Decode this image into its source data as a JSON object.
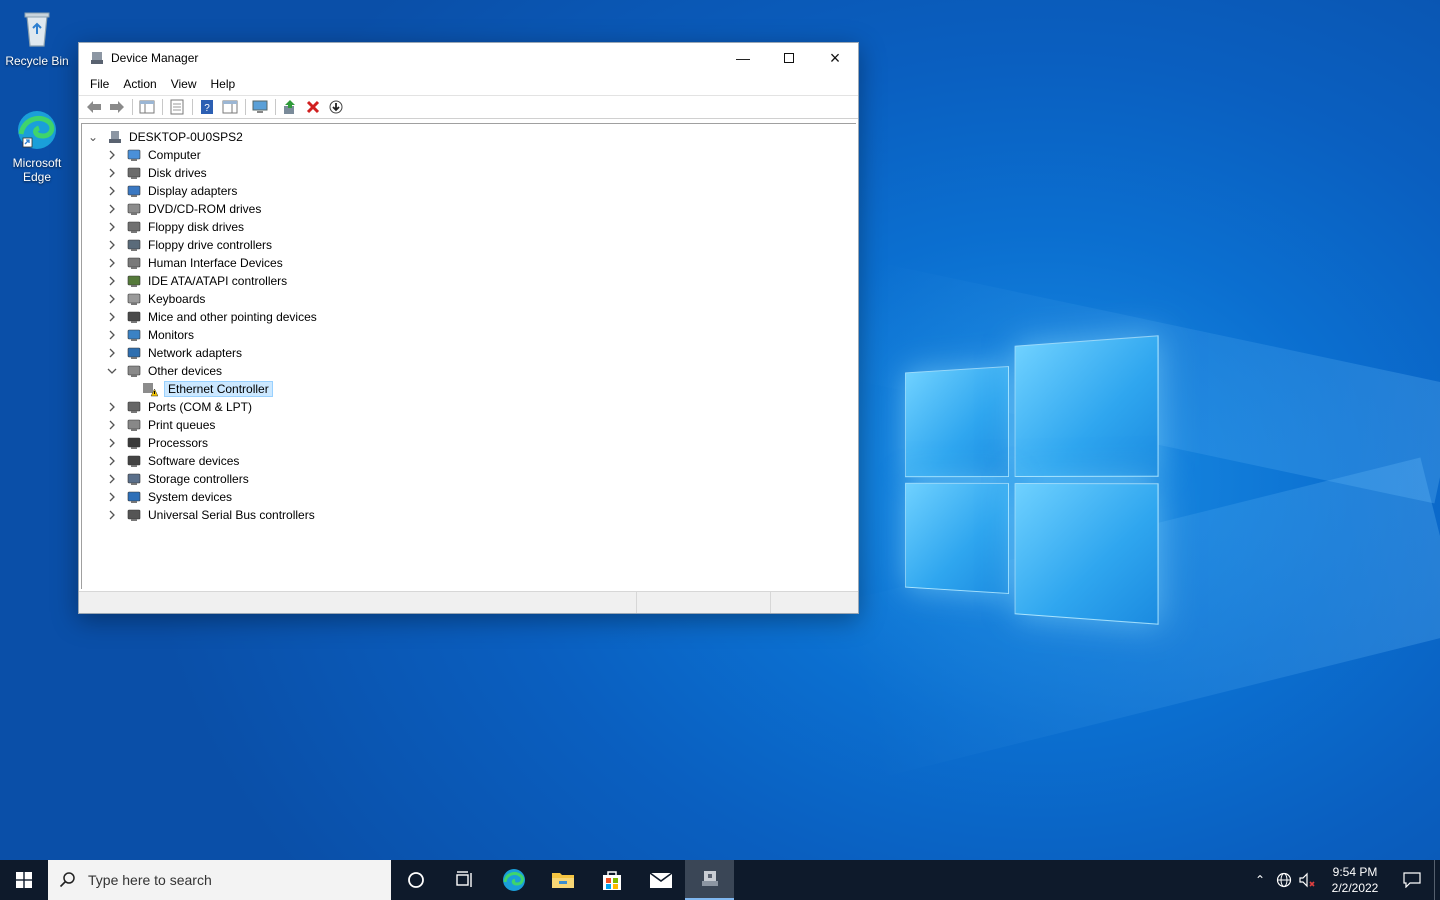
{
  "desktop": {
    "icons": [
      {
        "label": "Recycle Bin",
        "icon": "recycle-bin-icon"
      },
      {
        "label": "Microsoft Edge",
        "icon": "edge-icon"
      }
    ]
  },
  "window": {
    "title": "Device Manager",
    "controls": {
      "minimize": "minimize-icon",
      "maximize": "maximize-icon",
      "close": "close-icon"
    },
    "menu": [
      "File",
      "Action",
      "View",
      "Help"
    ],
    "toolbar_icons": [
      "back-icon",
      "forward-icon",
      "show-hide-tree-icon",
      "properties-icon",
      "help-icon",
      "action-pane-icon",
      "scan-hardware-icon",
      "update-driver-icon",
      "uninstall-icon",
      "disable-icon"
    ],
    "tree": {
      "root": "DESKTOP-0U0SPS2",
      "items": [
        {
          "label": "Computer",
          "icon": "computer-icon",
          "expanded": false
        },
        {
          "label": "Disk drives",
          "icon": "disk-drive-icon",
          "expanded": false
        },
        {
          "label": "Display adapters",
          "icon": "display-adapter-icon",
          "expanded": false
        },
        {
          "label": "DVD/CD-ROM drives",
          "icon": "dvd-icon",
          "expanded": false
        },
        {
          "label": "Floppy disk drives",
          "icon": "floppy-icon",
          "expanded": false
        },
        {
          "label": "Floppy drive controllers",
          "icon": "floppy-controller-icon",
          "expanded": false
        },
        {
          "label": "Human Interface Devices",
          "icon": "hid-icon",
          "expanded": false
        },
        {
          "label": "IDE ATA/ATAPI controllers",
          "icon": "ide-icon",
          "expanded": false
        },
        {
          "label": "Keyboards",
          "icon": "keyboard-icon",
          "expanded": false
        },
        {
          "label": "Mice and other pointing devices",
          "icon": "mouse-icon",
          "expanded": false
        },
        {
          "label": "Monitors",
          "icon": "monitor-icon",
          "expanded": false
        },
        {
          "label": "Network adapters",
          "icon": "network-adapter-icon",
          "expanded": false
        },
        {
          "label": "Other devices",
          "icon": "unknown-device-icon",
          "expanded": true
        },
        {
          "label": "Ports (COM & LPT)",
          "icon": "port-icon",
          "expanded": false
        },
        {
          "label": "Print queues",
          "icon": "printer-icon",
          "expanded": false
        },
        {
          "label": "Processors",
          "icon": "processor-icon",
          "expanded": false
        },
        {
          "label": "Software devices",
          "icon": "software-device-icon",
          "expanded": false
        },
        {
          "label": "Storage controllers",
          "icon": "storage-controller-icon",
          "expanded": false
        },
        {
          "label": "System devices",
          "icon": "system-device-icon",
          "expanded": false
        },
        {
          "label": "Universal Serial Bus controllers",
          "icon": "usb-icon",
          "expanded": false
        }
      ],
      "child_of_other_devices": {
        "label": "Ethernet Controller",
        "icon": "warning-device-icon",
        "selected": true
      }
    }
  },
  "taskbar": {
    "search_placeholder": "Type here to search",
    "apps": [
      "cortana-icon",
      "task-view-icon",
      "edge-icon",
      "file-explorer-icon",
      "store-icon",
      "mail-icon",
      "device-manager-icon"
    ],
    "clock_time": "9:54 PM",
    "clock_date": "2/2/2022"
  },
  "colors": {
    "accent": "#0078d7",
    "selection": "#cce8ff",
    "taskbar": "#0e1a2b"
  }
}
